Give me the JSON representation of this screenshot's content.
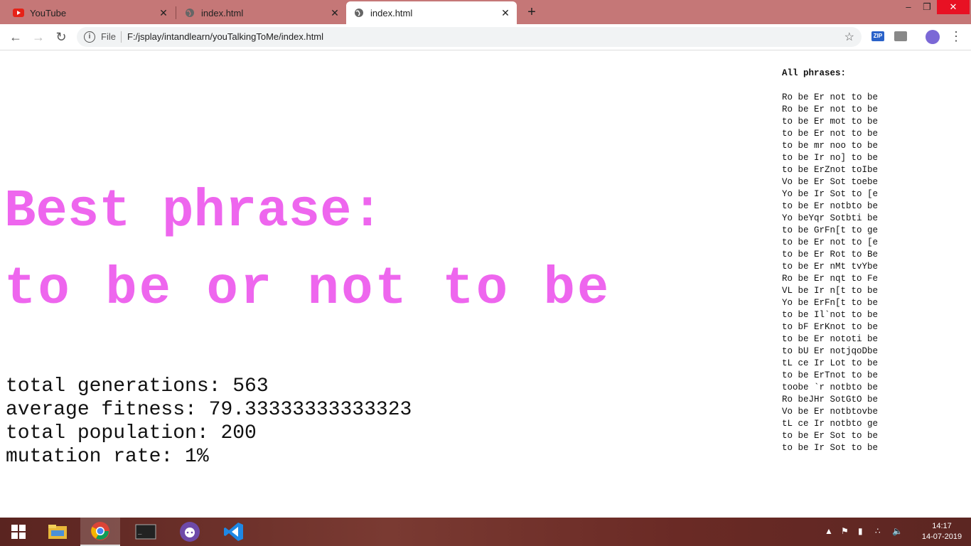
{
  "tabs": [
    {
      "title": "YouTube",
      "icon": "youtube-icon"
    },
    {
      "title": "index.html",
      "icon": "globe-icon"
    },
    {
      "title": "index.html",
      "icon": "globe-icon",
      "active": true
    }
  ],
  "toolbar": {
    "scheme_label": "File",
    "url": "F:/jsplay/intandlearn/youTalkingToMe/index.html",
    "ext_zip_label": "ZIP"
  },
  "main": {
    "best_title": "Best phrase:",
    "best_phrase": "to be or not to be",
    "stats": [
      "total generations: 563",
      "average fitness: 79.33333333333323",
      "total population: 200",
      "mutation rate: 1%"
    ]
  },
  "phrases": {
    "header": "All phrases:",
    "items": [
      "Ro be Er not to be",
      "Ro be Er not to be",
      "to be Er mot to be",
      "to be Er not to be",
      "to be mr noo to be",
      "to be Ir no] to be",
      "to be ErZnot toIbe",
      "Vo be Er Sot toebe",
      "Yo be Ir Sot to [e",
      "to be Er notbto be",
      "Yo beYqr Sotbti be",
      "to be GrFn[t to ge",
      "to be Er not to [e",
      "to be Er Rot to Be",
      "to be Er nMt tvYbe",
      "Ro be Er nqt to Fe",
      "VL be Ir n[t to be",
      "Yo be ErFn[t to be",
      "to be Il`not to be",
      "to bF ErKnot to be",
      "to be Er nototi be",
      "to bU Er notjqoDbe",
      "tL ce Ir Lot to be",
      "to be ErTnot to be",
      "toobe `r notbto be",
      "Ro beJHr SotGtO be",
      "Vo be Er notbtovbe",
      "tL ce Ir notbto ge",
      "to be Er Sot to be",
      "to be Ir Sot to be"
    ]
  },
  "taskbar": {
    "time": "14:17",
    "date": "14-07-2019"
  },
  "colors": {
    "best_phrase": "#ee66ee",
    "tabstrip": "#c57777"
  }
}
